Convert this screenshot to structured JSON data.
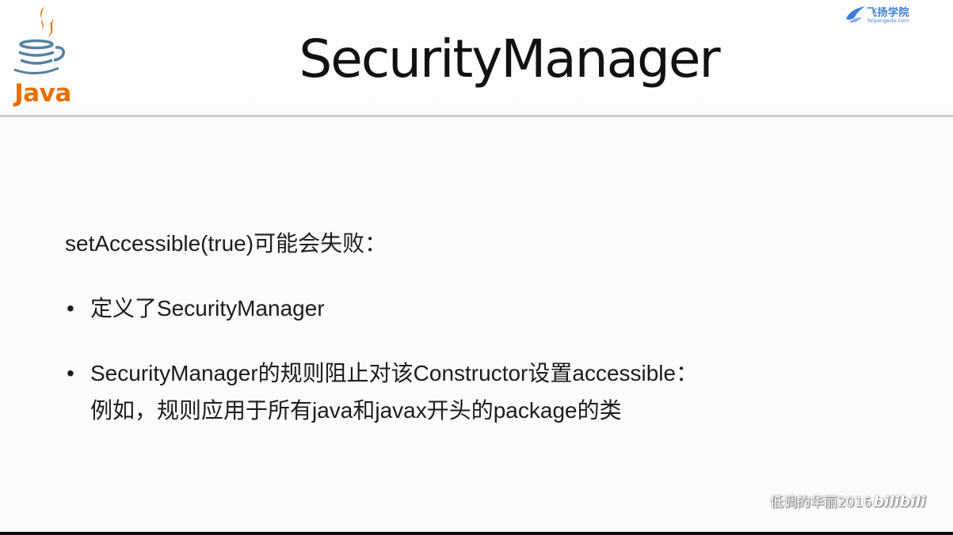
{
  "header": {
    "title": "SecurityManager",
    "java_logo_text": "Java",
    "brand_name": "飞扬学院",
    "brand_url": "feiyangedu.com"
  },
  "body": {
    "intro": "setAccessible(true)可能会失败：",
    "bullets": [
      {
        "lines": [
          "定义了SecurityManager"
        ]
      },
      {
        "lines": [
          "SecurityManager的规则阻止对该Constructor设置accessible：",
          "例如，规则应用于所有java和javax开头的package的类"
        ]
      }
    ],
    "bullet_symbol": "•"
  },
  "watermark": {
    "text": "低调的华丽2016",
    "logo": "bilibili"
  },
  "colors": {
    "java_orange": "#e76f00",
    "java_blue": "#5382a1",
    "brand_blue": "#3b7fd6",
    "rule": "#cfcfcf"
  },
  "icons": {
    "java_logo": "java-coffee-cup-icon",
    "brand_logo": "bird-wing-icon"
  }
}
